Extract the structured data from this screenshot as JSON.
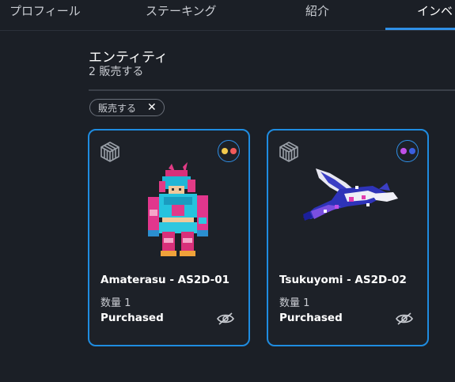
{
  "tabs": [
    {
      "label": "プロフィール"
    },
    {
      "label": "ステーキング"
    },
    {
      "label": "紹介"
    },
    {
      "label": "インベ"
    }
  ],
  "section": {
    "title": "エンティティ",
    "subtitle": "2 販売する"
  },
  "filter_chip": {
    "label": "販売する",
    "close": "✕"
  },
  "cards": [
    {
      "name": "Amaterasu - AS2D-01",
      "quantity": "数量 1",
      "status": "Purchased",
      "type_icon": "voxel-cube-icon",
      "colors": [
        "#f2c94c",
        "#f25a5a"
      ]
    },
    {
      "name": "Tsukuyomi - AS2D-02",
      "quantity": "数量 1",
      "status": "Purchased",
      "type_icon": "voxel-cube-icon",
      "colors": [
        "#c050e8",
        "#3b5fe0"
      ]
    }
  ],
  "colors": {
    "accent": "#1f8ce0",
    "background": "#1b1f26"
  }
}
